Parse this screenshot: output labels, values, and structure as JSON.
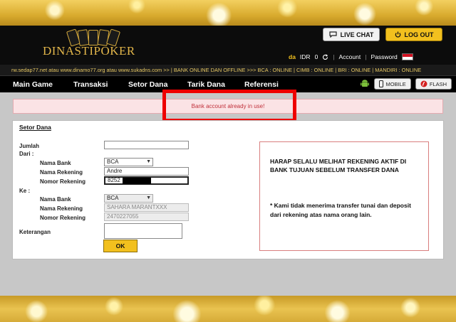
{
  "header": {
    "logo_text": "DINASTIPOKER",
    "live_chat_label": "LIVE CHAT",
    "logout_label": "LOG OUT",
    "username": "da",
    "currency": "IDR",
    "balance": "0",
    "account_link": "Account",
    "password_link": "Password"
  },
  "marquee": {
    "text": "rw.sedap77.net atau www.dinamo77.org atau www.sukadns.com >> | BANK ONLINE DAN OFFLINE >>> BCA : ONLINE | CIMB : ONLINE | BRI : ONLINE | MANDIRI : ONLINE"
  },
  "nav": {
    "items": [
      {
        "label": "Main Game"
      },
      {
        "label": "Transaksi"
      },
      {
        "label": "Setor Dana"
      },
      {
        "label": "Tarik Dana"
      },
      {
        "label": "Referensi"
      }
    ],
    "mobile_label": "MOBILE",
    "flash_label": "FLASH"
  },
  "alert": {
    "message": "Bank account already in use!"
  },
  "form": {
    "title": "Setor Dana",
    "jumlah_label": "Jumlah",
    "jumlah_value": "",
    "dari_label": "Dari :",
    "ke_label": "Ke :",
    "dari": {
      "bank_label": "Nama Bank",
      "bank_value": "BCA",
      "rekening_label": "Nama Rekening",
      "rekening_value": "Andre",
      "nomor_label": "Nomor Rekening",
      "nomor_value": "8252"
    },
    "ke": {
      "bank_label": "Nama Bank",
      "bank_value": "BCA",
      "rekening_label": "Nama Rekening",
      "rekening_value": "SAHARA MARANTXXX",
      "nomor_label": "Nomor Rekening",
      "nomor_value": "2470227055"
    },
    "keterangan_label": "Keterangan",
    "keterangan_value": "",
    "ok_label": "OK"
  },
  "notice": {
    "heading": "HARAP SELALU MELIHAT REKENING AKTIF DI BANK TUJUAN SEBELUM TRANSFER DANA",
    "body": "* Kami tidak menerima transfer tunai dan deposit dari rekening atas nama orang lain."
  },
  "colors": {
    "accent": "#f2c01e",
    "alert_text": "#c0303a",
    "highlight": "#ee0000"
  }
}
